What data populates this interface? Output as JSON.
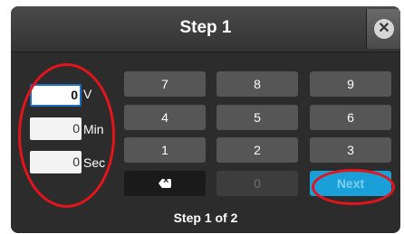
{
  "dialog": {
    "title": "Step 1",
    "close_icon": "close-icon",
    "footer": "Step 1 of 2"
  },
  "inputs": [
    {
      "value": "0",
      "unit": "V",
      "active": true
    },
    {
      "value": "0",
      "unit": "Min",
      "active": false
    },
    {
      "value": "0",
      "unit": "Sec",
      "active": false
    }
  ],
  "keypad": {
    "row1": [
      "7",
      "8",
      "9"
    ],
    "row2": [
      "4",
      "5",
      "6"
    ],
    "row3": [
      "1",
      "2",
      "3"
    ],
    "zero": "0",
    "backspace_icon": "backspace-icon",
    "next": "Next"
  },
  "colors": {
    "annotation": "#e3141c",
    "active_field_border": "#1d6fbf",
    "next_button": "#1aa0d8"
  }
}
